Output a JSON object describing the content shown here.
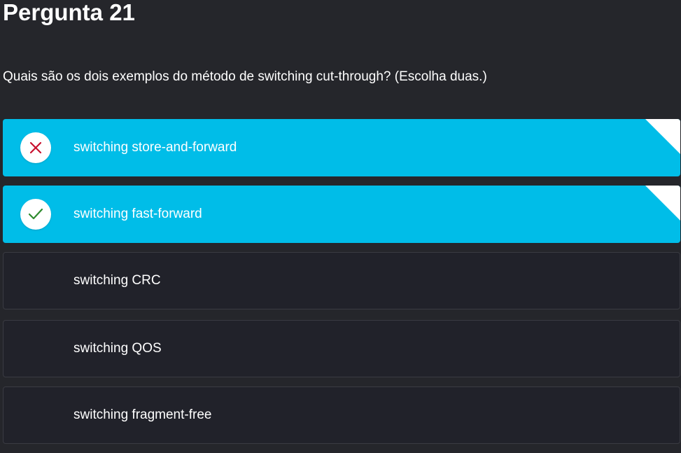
{
  "question": {
    "title": "Pergunta 21",
    "text": "Quais são os dois exemplos do método de switching cut-through? (Escolha duas.)"
  },
  "options": [
    {
      "label": "switching store-and-forward",
      "selected": true,
      "result": "incorrect",
      "icon": "x-icon",
      "icon_color": "#c8102e"
    },
    {
      "label": "switching fast-forward",
      "selected": true,
      "result": "correct",
      "icon": "check-icon",
      "icon_color": "#2e8b2e"
    },
    {
      "label": "switching CRC",
      "selected": false
    },
    {
      "label": "switching QOS",
      "selected": false
    },
    {
      "label": "switching fragment-free",
      "selected": false
    }
  ],
  "colors": {
    "background": "#25262b",
    "selected_option": "#00bde8",
    "unselected_option": "#21222a"
  }
}
